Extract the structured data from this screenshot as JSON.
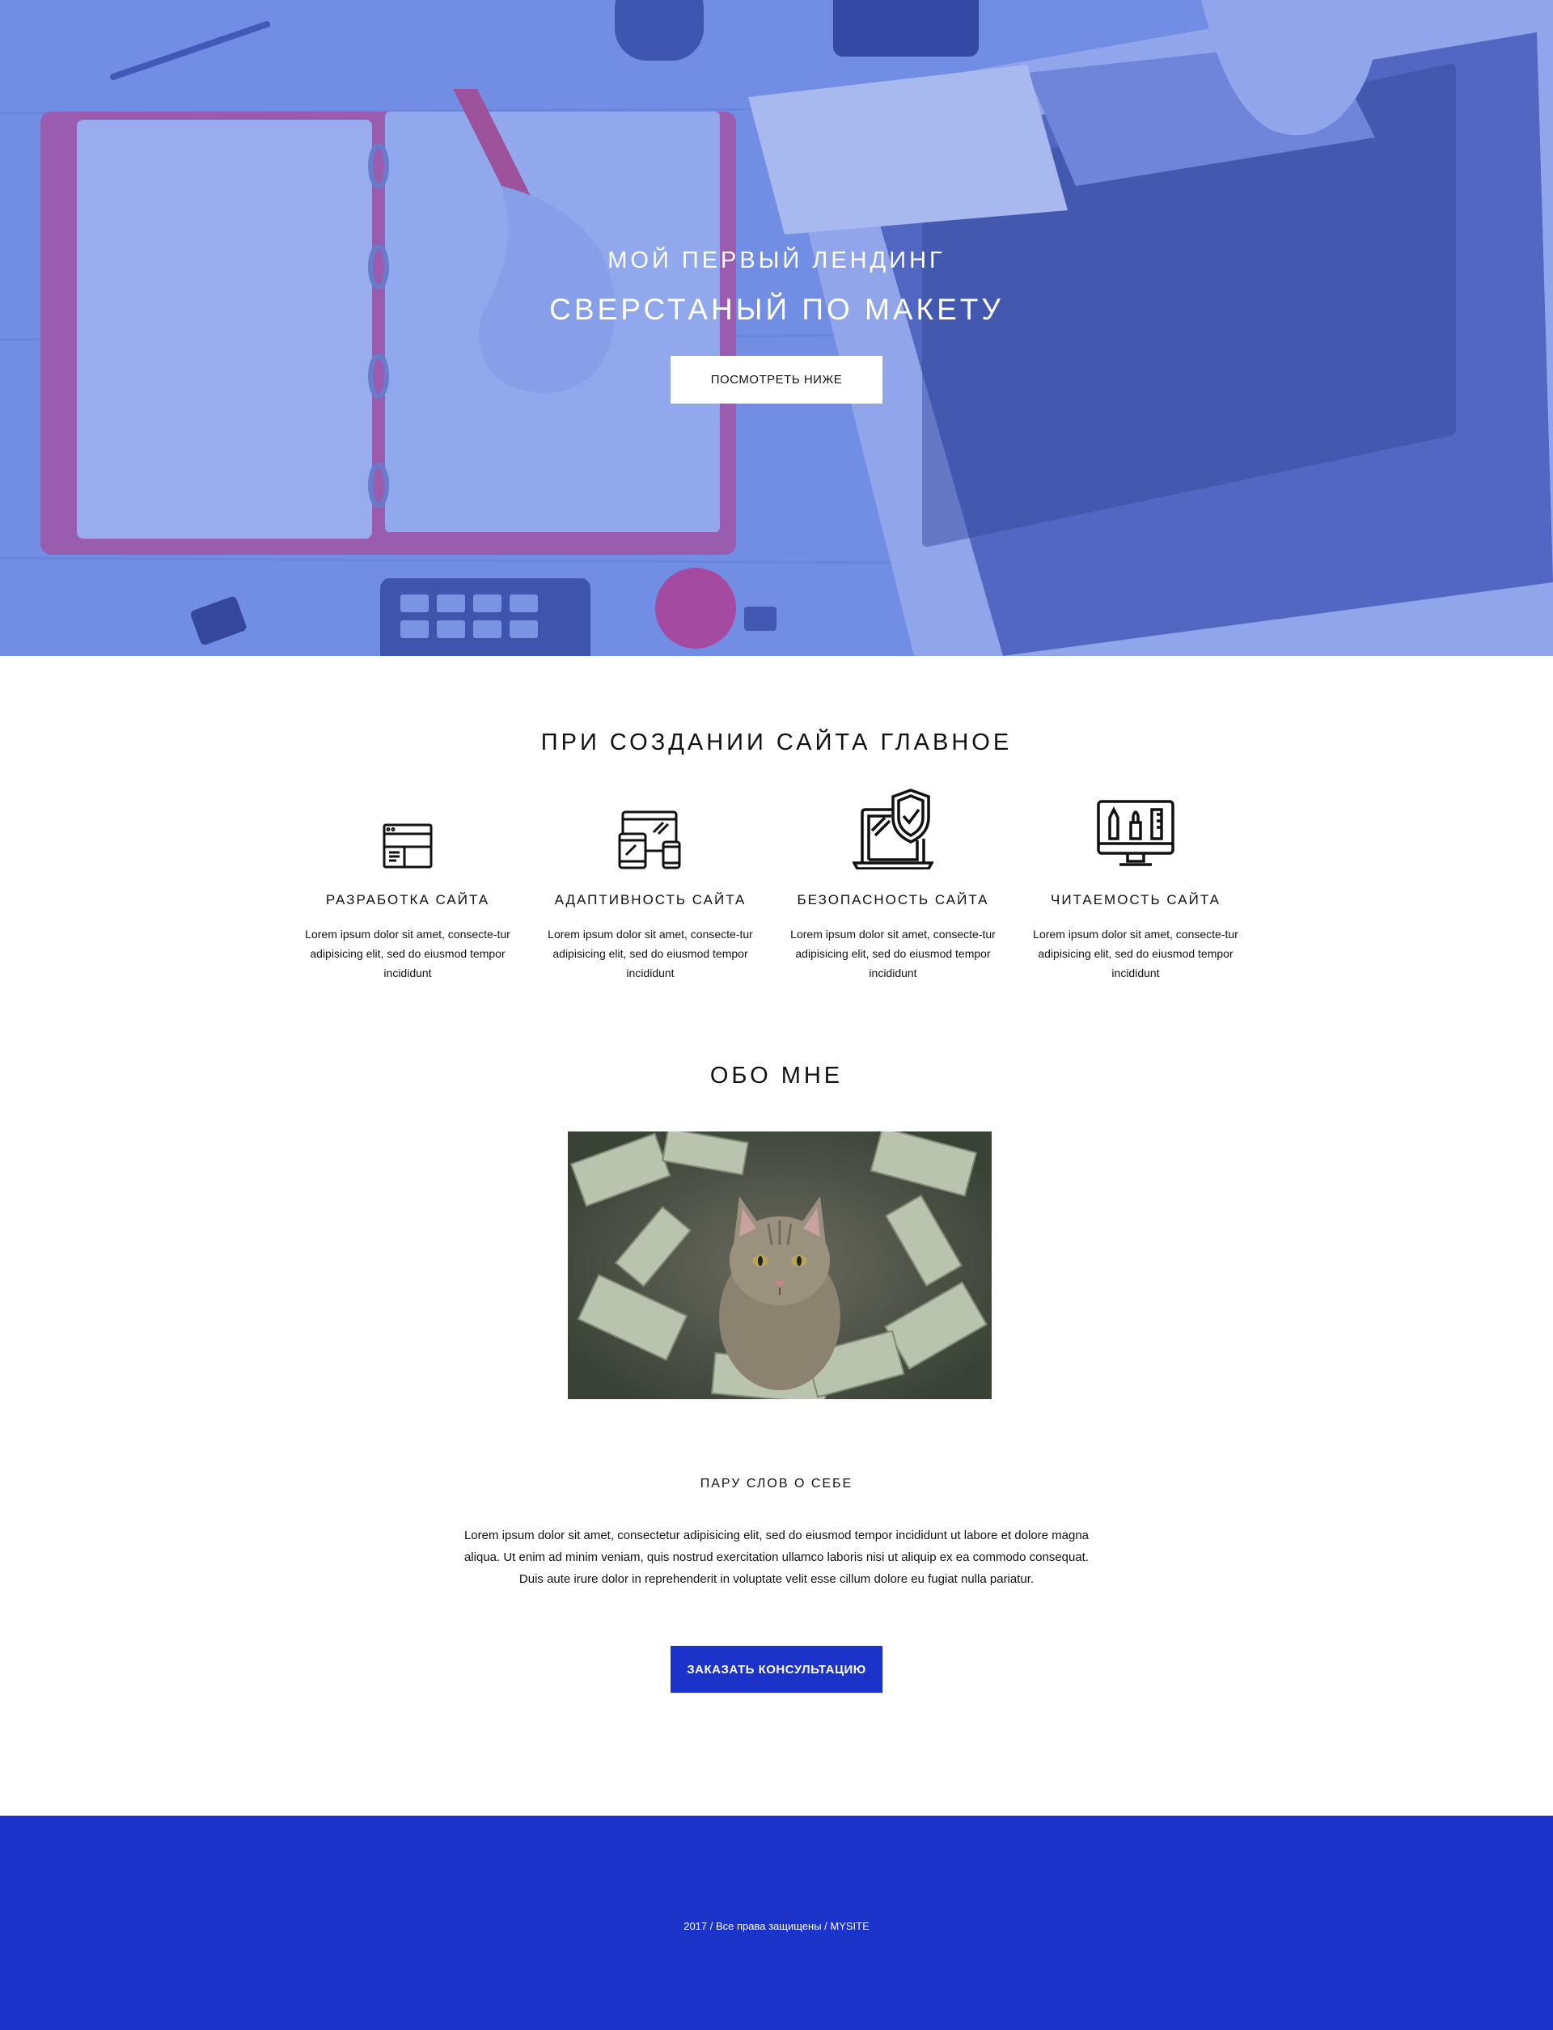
{
  "hero": {
    "title_line1": "МОЙ ПЕРВЫЙ ЛЕНДИНГ",
    "title_line2": "СВЕРСТАНЫЙ ПО МАКЕТУ",
    "button_label": "ПОСМОТРЕТЬ НИЖЕ",
    "overlay_color": "#7c97e6"
  },
  "features": {
    "title": "ПРИ СОЗДАНИИ САЙТА ГЛАВНОЕ",
    "items": [
      {
        "title": "РАЗРАБОТКА САЙТА",
        "text": "Lorem ipsum dolor sit amet, consecte-tur adipisicing elit, sed do eiusmod tempor incididunt",
        "icon": "web-layout-icon"
      },
      {
        "title": "АДАПТИВНОСТЬ САЙТА",
        "text": "Lorem ipsum dolor sit amet, consecte-tur adipisicing elit, sed do eiusmod tempor incididunt",
        "icon": "responsive-devices-icon"
      },
      {
        "title": "БЕЗОПАСНОСТЬ САЙТА",
        "text": "Lorem ipsum dolor sit amet, consecte-tur adipisicing elit, sed do eiusmod tempor incididunt",
        "icon": "laptop-shield-icon"
      },
      {
        "title": "ЧИТАЕМОСТЬ САЙТА",
        "text": "Lorem ipsum dolor sit amet, consecte-tur adipisicing elit, sed do eiusmod tempor incididunt",
        "icon": "monitor-design-tools-icon"
      }
    ]
  },
  "about": {
    "title": "ОБО МНЕ",
    "subtitle": "ПАРУ СЛОВ О СЕБЕ",
    "text": "Lorem ipsum dolor sit amet, consectetur adipisicing elit, sed do eiusmod tempor incididunt ut labore et dolore magna aliqua. Ut enim ad minim veniam, quis nostrud exercitation ullamco laboris nisi ut aliquip ex ea commodo consequat. Duis aute irure dolor in reprehenderit in voluptate velit esse cillum dolore eu fugiat nulla pariatur.",
    "button_label": "ЗАКАЗАТЬ КОНСУЛЬТАЦИЮ",
    "photo": "cat-in-dollar-bills-photo"
  },
  "footer": {
    "text": "2017 / Все права защищены / MYSITE",
    "color": "#1c33c9"
  }
}
